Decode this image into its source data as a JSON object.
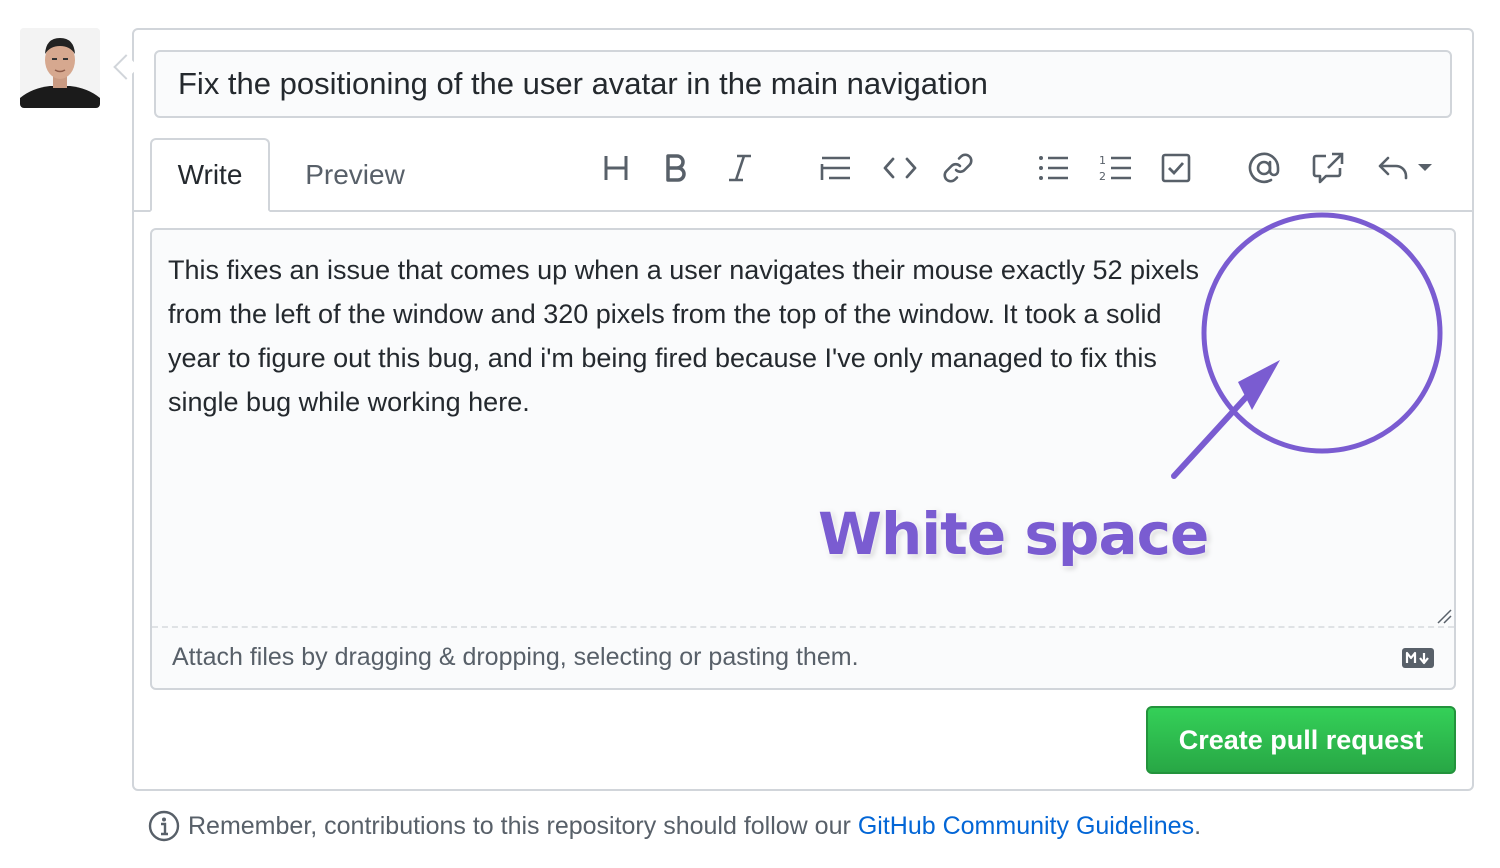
{
  "pull_request": {
    "title_value": "Fix the positioning of the user avatar in the main navigation",
    "tabs": [
      {
        "label": "Write",
        "active": true
      },
      {
        "label": "Preview",
        "active": false
      }
    ],
    "toolbar_icons": [
      "heading-icon",
      "bold-icon",
      "italic-icon",
      "quote-icon",
      "code-icon",
      "link-icon",
      "bulleted-list-icon",
      "numbered-list-icon",
      "task-list-icon",
      "mention-icon",
      "cross-reference-icon",
      "reply-icon"
    ],
    "body_text": "This fixes an issue that comes up when a user navigates their mouse exactly 52 pixels from the left of the window and 320 pixels from the top of the window. It took a solid year to figure out this bug, and i'm being fired because I've only managed to fix this single bug while working here.",
    "attach_hint": "Attach files by dragging & dropping, selecting or pasting them.",
    "submit_label": "Create pull request"
  },
  "annotation": {
    "label": "White space",
    "color": "#7a5cd1"
  },
  "footer": {
    "text": "Remember, contributions to this repository should follow our",
    "link_text": "GitHub Community Guidelines",
    "suffix": "."
  },
  "colors": {
    "accent_green": "#28a745",
    "link_blue": "#0366d6",
    "border": "#d1d5da"
  }
}
